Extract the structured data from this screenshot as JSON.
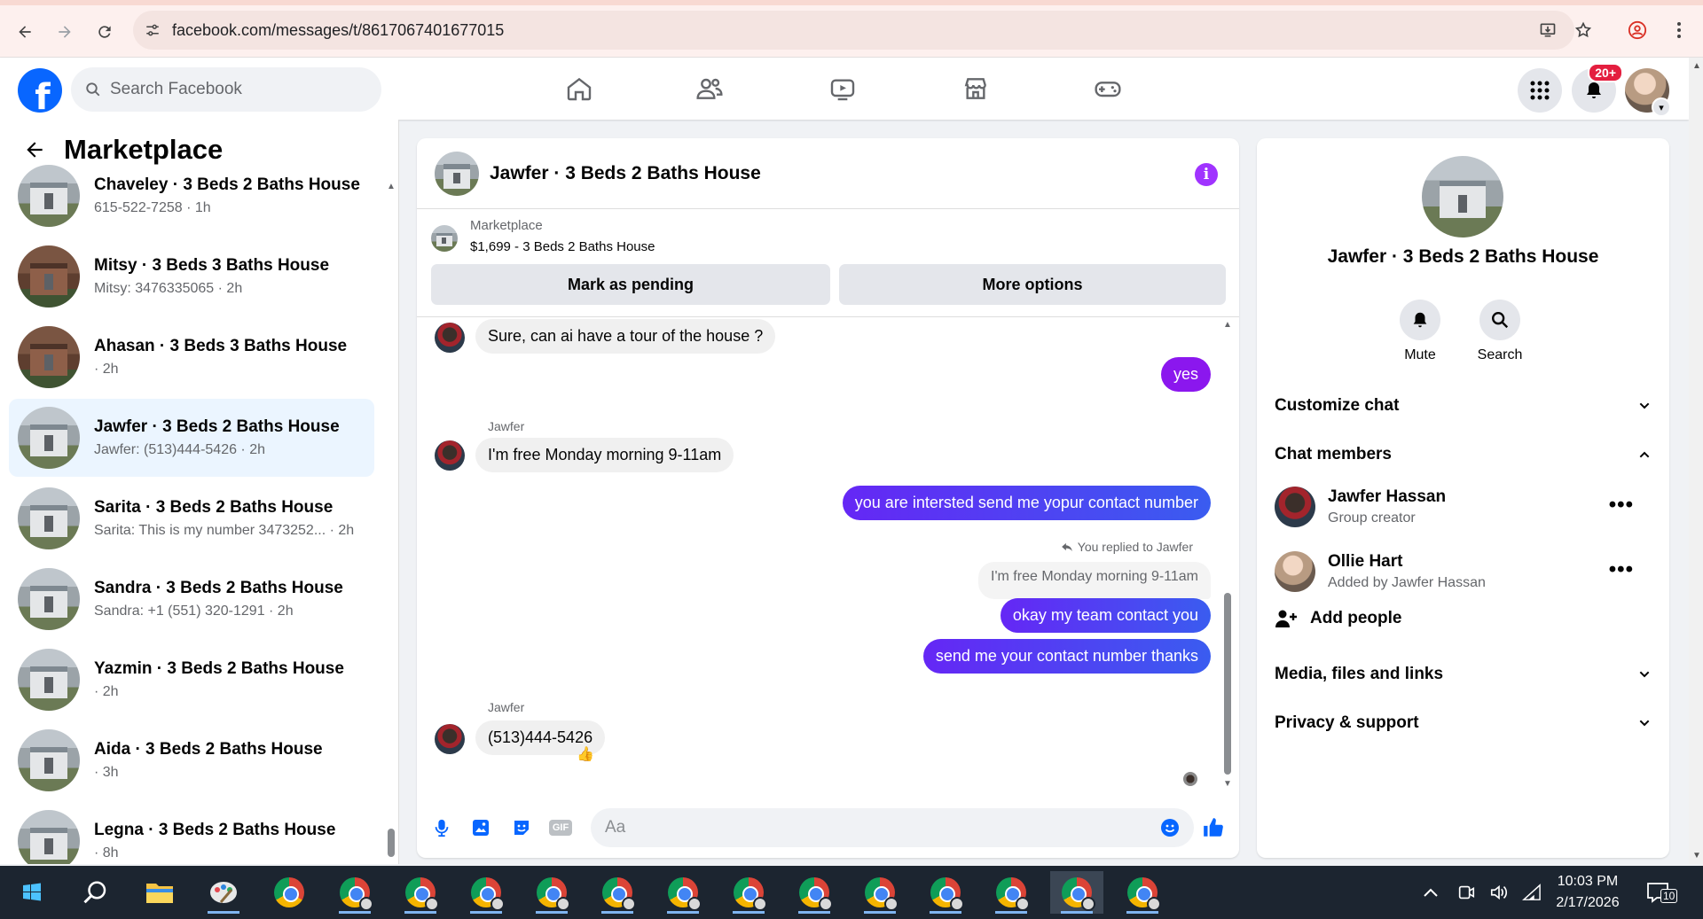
{
  "browser": {
    "url": "facebook.com/messages/t/8617067401677015"
  },
  "fb": {
    "search_placeholder": "Search Facebook",
    "notif_count": "20+",
    "nav_icons": [
      "home-icon",
      "friends-icon",
      "watch-icon",
      "marketplace-icon",
      "gaming-icon"
    ]
  },
  "sidebar": {
    "title": "Marketplace",
    "conversations": [
      {
        "name": "Chaveley · 3 Beds 2 Baths House",
        "sub": "615-522-7258 · 1h",
        "brick": false,
        "active": false
      },
      {
        "name": "Mitsy · 3 Beds 3 Baths House",
        "sub": "Mitsy: 3476335065 · 2h",
        "brick": true,
        "active": false
      },
      {
        "name": "Ahasan · 3 Beds 3 Baths House",
        "sub": "· 2h",
        "brick": true,
        "active": false
      },
      {
        "name": "Jawfer · 3 Beds 2 Baths House",
        "sub": "Jawfer: (513)444-5426 · 2h",
        "brick": false,
        "active": true
      },
      {
        "name": "Sarita · 3 Beds 2 Baths House",
        "sub": "Sarita: This is my number 3473252...  · 2h",
        "brick": false,
        "active": false
      },
      {
        "name": "Sandra · 3 Beds 2 Baths House",
        "sub": "Sandra: +1 (551) 320-1291 · 2h",
        "brick": false,
        "active": false
      },
      {
        "name": "Yazmin · 3 Beds 2 Baths House",
        "sub": "· 2h",
        "brick": false,
        "active": false
      },
      {
        "name": "Aida · 3 Beds 2 Baths House",
        "sub": "· 3h",
        "brick": false,
        "active": false
      },
      {
        "name": "Legna · 3 Beds 2 Baths House",
        "sub": "· 8h",
        "brick": false,
        "active": false
      }
    ]
  },
  "chat": {
    "title": "Jawfer · 3 Beds 2 Baths House",
    "marketplace_label": "Marketplace",
    "listing": "$1,699 - 3 Beds 2 Baths House",
    "btn_pending": "Mark as pending",
    "btn_more": "More options",
    "messages": {
      "m1": "Sure, can ai have a tour of the house ?",
      "m2": "yes",
      "sender1": "Jawfer",
      "m3": "I'm free Monday morning 9-11am",
      "m4": "you are intersted send me yopur contact number",
      "replied_label": "You replied to Jawfer",
      "quote": "I'm free Monday morning 9-11am",
      "m5": "okay my team contact you",
      "m6": "send me your contact number thanks",
      "sender2": "Jawfer",
      "m7": "(513)444-5426",
      "reaction": "👍"
    },
    "composer_placeholder": "Aa",
    "gif_label": "GIF"
  },
  "right": {
    "title": "Jawfer · 3 Beds 2 Baths House",
    "mute": "Mute",
    "search": "Search",
    "customize": "Customize chat",
    "members_header": "Chat members",
    "members": [
      {
        "name": "Jawfer Hassan",
        "role": "Group creator"
      },
      {
        "name": "Ollie Hart",
        "role": "Added by Jawfer Hassan"
      }
    ],
    "add_people": "Add people",
    "media": "Media, files and links",
    "privacy": "Privacy & support"
  },
  "taskbar": {
    "time": "10:03 PM",
    "date": "2/17/2026",
    "notif_count": "10"
  },
  "colors": {
    "fb_blue": "#0866ff",
    "outgoing_bubble": "#5b35f2",
    "info_purple": "#a033ff",
    "active_conv": "#ebf5ff"
  }
}
